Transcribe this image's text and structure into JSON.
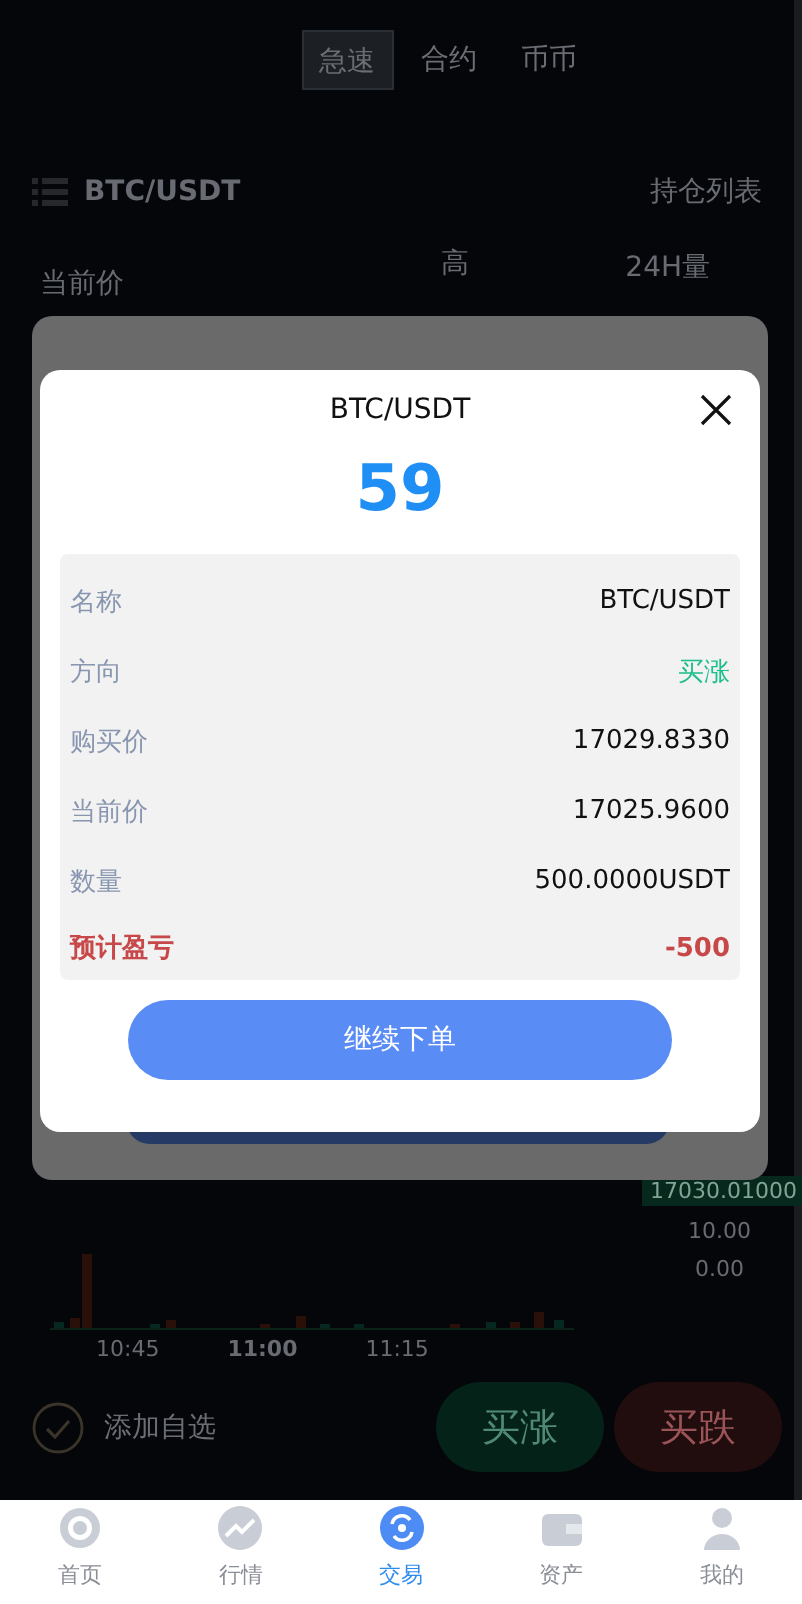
{
  "mode_tabs": [
    {
      "label": "急速",
      "selected": true
    },
    {
      "label": "合约",
      "selected": false
    },
    {
      "label": "币币",
      "selected": false
    }
  ],
  "header": {
    "pair": "BTC/USDT",
    "positions_link": "持仓列表"
  },
  "stats": [
    "当前价",
    "高",
    "24H量"
  ],
  "chart": {
    "price_tag": "17030.01000",
    "y_labels": [
      "10.00",
      "0.00"
    ],
    "x_labels": [
      {
        "text": "10:45",
        "bold": false
      },
      {
        "text": "11:00",
        "bold": true
      },
      {
        "text": "11:15",
        "bold": false
      }
    ]
  },
  "favorite": {
    "label": "添加自选",
    "checked": true
  },
  "trade_buttons": [
    {
      "label": "买涨",
      "kind": "up"
    },
    {
      "label": "买跌",
      "kind": "down"
    }
  ],
  "modal": {
    "title": "BTC/USDT",
    "countdown": "59",
    "rows": [
      {
        "label": "名称",
        "value": "BTC/USDT",
        "kind": "plain"
      },
      {
        "label": "方向",
        "value": "买涨",
        "kind": "up"
      },
      {
        "label": "购买价",
        "value": "17029.8330",
        "kind": "plain"
      },
      {
        "label": "当前价",
        "value": "17025.9600",
        "kind": "plain"
      },
      {
        "label": "数量",
        "value": "500.0000USDT",
        "kind": "plain"
      },
      {
        "label": "预计盈亏",
        "value": "-500",
        "kind": "loss"
      }
    ],
    "button": "继续下单"
  },
  "nav": [
    {
      "label": "首页",
      "selected": false
    },
    {
      "label": "行情",
      "selected": false
    },
    {
      "label": "交易",
      "selected": true
    },
    {
      "label": "资产",
      "selected": false
    },
    {
      "label": "我的",
      "selected": false
    }
  ]
}
